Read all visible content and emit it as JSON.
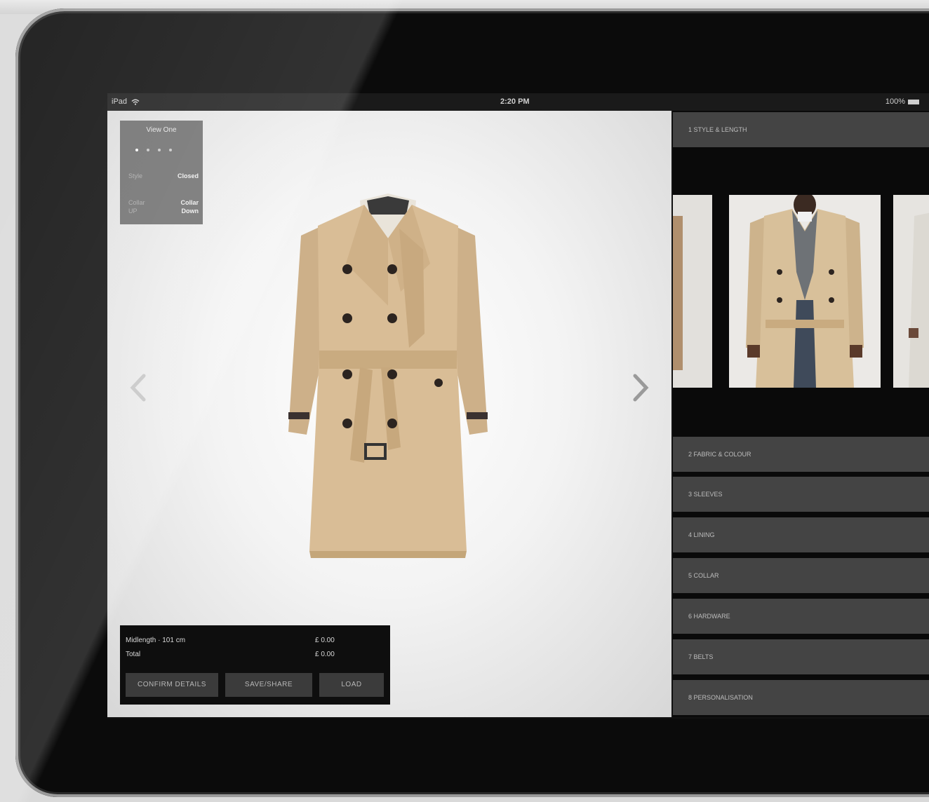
{
  "status_bar": {
    "device": "iPad",
    "time": "2:20 PM",
    "battery": "100%"
  },
  "view_panel": {
    "title": "View One",
    "rows": [
      {
        "key": "Style",
        "value": "Closed"
      },
      {
        "key": "Collar",
        "value": "Collar"
      },
      {
        "key": "UP",
        "value": "Down"
      }
    ]
  },
  "price_box": {
    "rows": [
      {
        "label": "Midlength · 101 cm",
        "amount": "£ 0.00"
      },
      {
        "label": "Total",
        "amount": "£ 0.00"
      }
    ],
    "buttons": [
      "CONFIRM DETAILS",
      "SAVE/SHARE",
      "LOAD"
    ]
  },
  "steps": [
    "1 STYLE & LENGTH",
    "2 FABRIC & COLOUR",
    "3 SLEEVES",
    "4 LINING",
    "5 COLLAR",
    "6 HARDWARE",
    "7 BELTS",
    "8 PERSONALISATION"
  ],
  "colors": {
    "coat": "#d9bd96",
    "bar": "#444444",
    "bezel": "#0b0b0b"
  },
  "icons": [
    "wifi-icon",
    "battery-icon",
    "chevron-left-icon",
    "chevron-right-icon"
  ]
}
